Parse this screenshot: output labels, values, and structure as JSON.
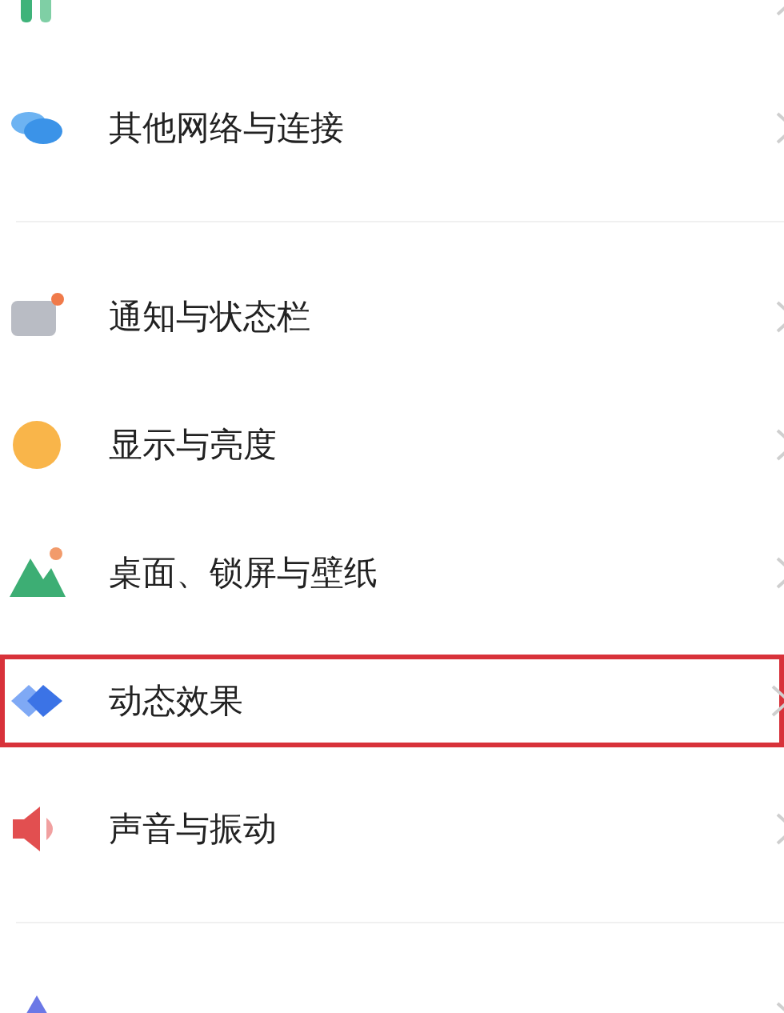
{
  "groups": [
    {
      "items": [
        {
          "kind": "signal",
          "highlighted": false
        },
        {
          "kind": "clouds",
          "label": "其他网络与连接",
          "highlighted": false
        }
      ]
    },
    {
      "items": [
        {
          "kind": "notification",
          "label": "通知与状态栏",
          "highlighted": false
        },
        {
          "kind": "sun",
          "label": "显示与亮度",
          "highlighted": false
        },
        {
          "kind": "landscape",
          "label": "桌面、锁屏与壁纸",
          "highlighted": false
        },
        {
          "kind": "diamond",
          "label": "动态效果",
          "highlighted": true
        },
        {
          "kind": "speaker",
          "label": "声音与振动",
          "highlighted": false
        }
      ]
    },
    {
      "items": [
        {
          "kind": "triangle",
          "highlighted": false
        }
      ]
    }
  ]
}
